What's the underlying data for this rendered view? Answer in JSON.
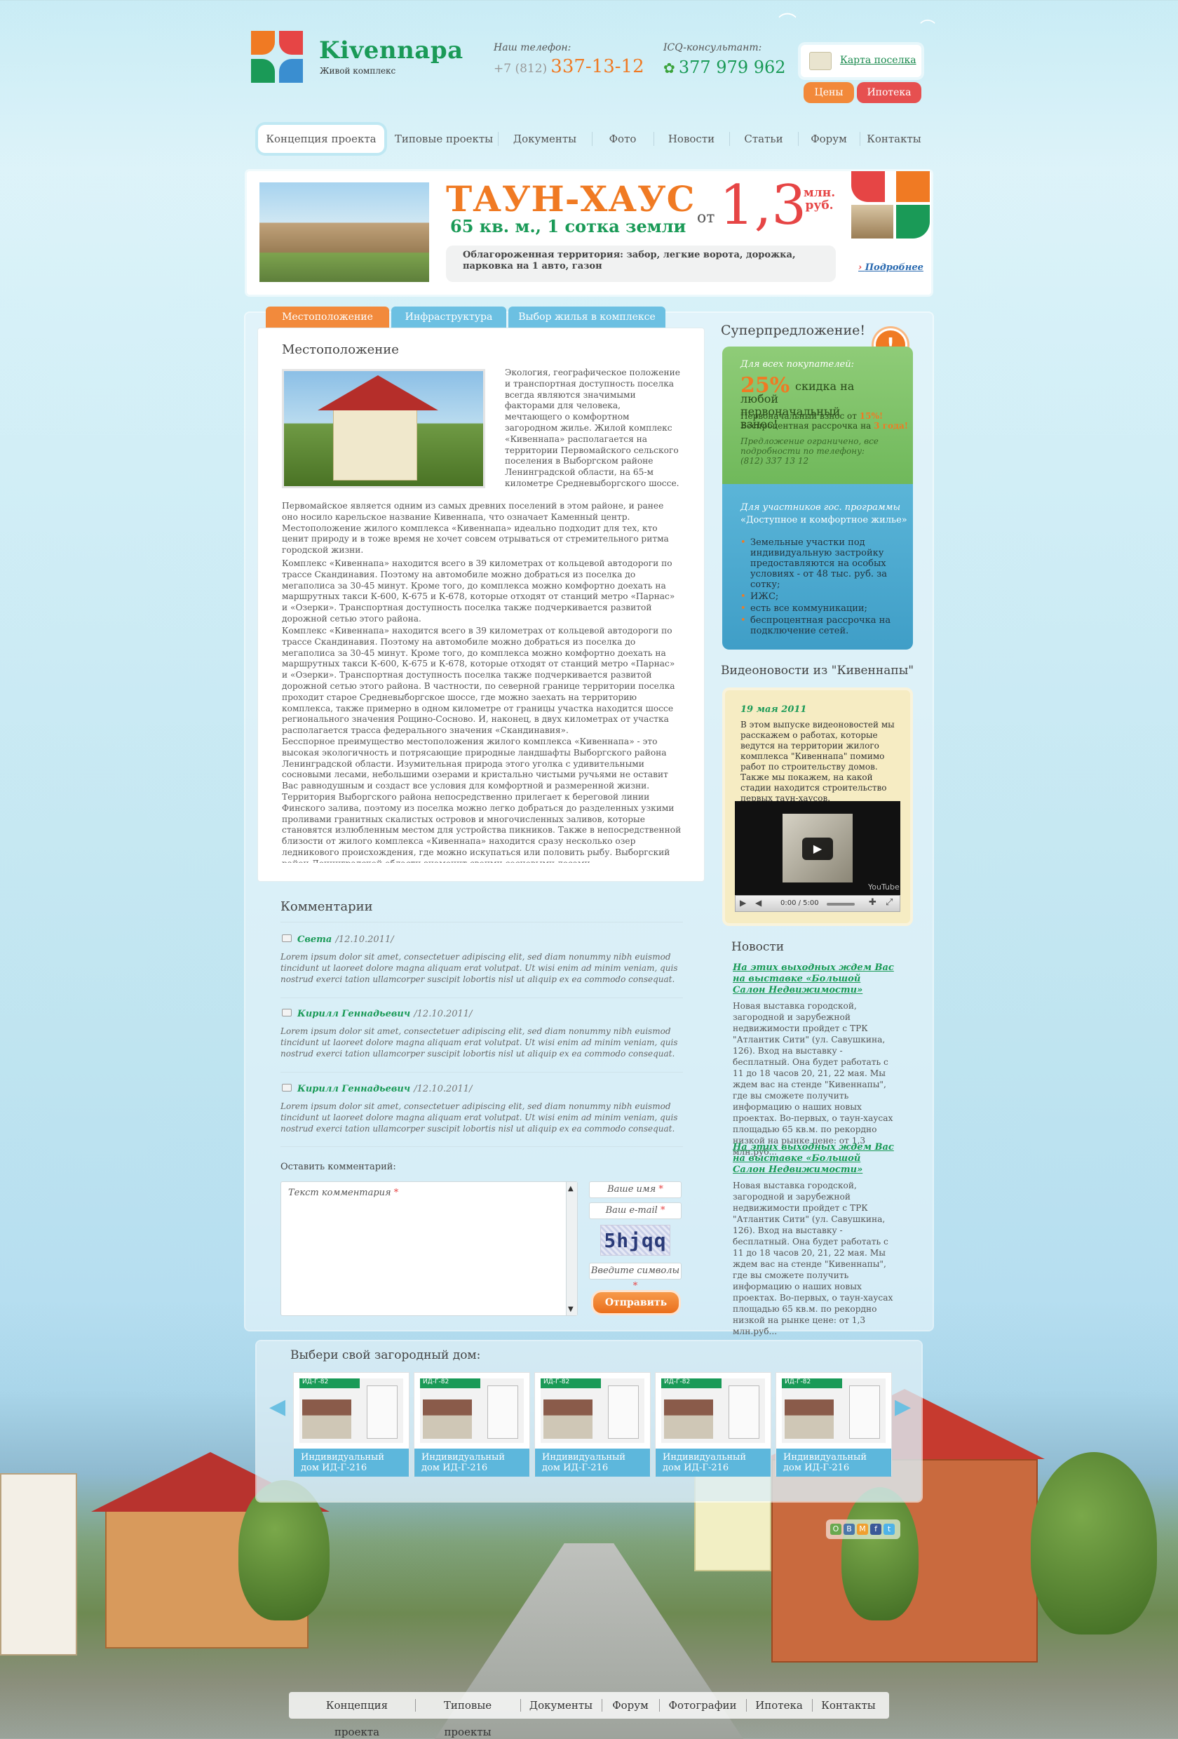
{
  "brand": {
    "name": "Kivennapa",
    "tagline": "Живой комплекс"
  },
  "header": {
    "phone_label": "Наш телефон:",
    "phone_prefix": "+7 (812)",
    "phone_number": "337-13-12",
    "icq_label": "ICQ-консультант:",
    "icq_number": "377 979 962",
    "map_link": "Карта поселка",
    "prices_button": "Цены",
    "mortgage_button": "Ипотека"
  },
  "nav": {
    "items": [
      "Концепция проекта",
      "Типовые проекты",
      "Документы",
      "Фото",
      "Новости",
      "Статьи",
      "Форум",
      "Контакты"
    ]
  },
  "banner": {
    "title": "ТАУН-ХАУС",
    "subtitle": "65 кв. м., 1 сотка земли",
    "price_prefix": "от",
    "price": "1,3",
    "price_unit_1": "млн.",
    "price_unit_2": "руб.",
    "description": "Облагороженная территория: забор, легкие ворота, дорожка, парковка на 1 авто, газон",
    "more_link": "Подробнее"
  },
  "tabs": [
    "Местоположение",
    "Инфраструктура",
    "Выбор жилья в комплексе"
  ],
  "article": {
    "heading": "Местоположение",
    "intro": "Экология, географическое положение и транспортная доступность поселка всегда являются значимыми факторами для человека, мечтающего о комфортном загородном жилье. Жилой комплекс «Кивеннапа» располагается на территории Первомайского сельского поселения в Выборгском районе Ленинградской области, на 65-м километре Средневыборгского шоссе.",
    "p1": "Первомайское является одним из самых древних поселений в этом районе, и ранее оно носило карельское название Кивеннапа, что означает Каменный центр. Местоположение жилого комплекса «Кивеннапа» идеально подходит для тех, кто ценит природу и в тоже время не хочет совсем отрываться от стремительного ритма городской жизни.",
    "p2": "Комплекс «Кивеннапа» находится всего в 39 километрах от кольцевой автодороги по трассе Скандинавия. Поэтому на автомобиле можно добраться из поселка до мегаполиса за 30-45 минут. Кроме того, до комплекса можно комфортно доехать на маршрутных такси К-600, К-675 и К-678, которые отходят от станций метро «Парнас» и «Озерки». Транспортная доступность поселка также подчеркивается развитой дорожной сетью этого района.",
    "p3": "Комплекс «Кивеннапа» находится всего в 39 километрах от кольцевой автодороги по трассе Скандинавия. Поэтому на автомобиле можно добраться из поселка до мегаполиса за 30-45 минут. Кроме того, до комплекса можно комфортно доехать на маршрутных такси К-600, К-675 и К-678, которые отходят от станций метро «Парнас» и «Озерки». Транспортная доступность поселка также подчеркивается развитой дорожной сетью этого района. В частности, по северной границе территории поселка проходит старое Средневыборгское шоссе, где можно заехать на территорию комплекса, также примерно в одном километре от границы участка находится шоссе регионального значения Рощино-Сосново. И, наконец, в двух километрах от участка располагается трасса федерального значения «Скандинавия».",
    "p4": "Бесспорное преимущество местоположения жилого комплекса «Кивеннапа» - это высокая экологичность и потрясающие природные ландшафты Выборгского района Ленинградской области. Изумительная природа этого уголка с удивительными сосновыми лесами, небольшими озерами и кристально чистыми ручьями не оставит Вас равнодушным и создаст все условия для комфортной и размеренной жизни. Территория Выборгского района непосредственно прилегает к береговой линии Финского залива, поэтому из поселка можно легко добраться до разделенных узкими проливами гранитных скалистых островов и многочисленных заливов, которые становятся излюбленным местом для устройства пикников. Также в непосредственной близости от жилого комплекса «Кивеннапа» находится сразу несколько озер ледникового происхождения, где можно искупаться или половить рыбу. Выборгский район Ленинградской области знаменит своими сосновыми лесами,"
  },
  "comments": {
    "heading": "Комментарии",
    "items": [
      {
        "name": "Света",
        "date": "/12.10.2011/",
        "text": "Lorem ipsum dolor sit amet, consectetuer adipiscing elit, sed diam nonummy nibh euismod tincidunt ut laoreet dolore magna aliquam erat volutpat. Ut wisi enim ad minim veniam, quis nostrud exerci tation ullamcorper suscipit lobortis nisl ut aliquip ex ea commodo consequat."
      },
      {
        "name": "Кирилл Геннадьевич",
        "date": "/12.10.2011/",
        "text": "Lorem ipsum dolor sit amet, consectetuer adipiscing elit, sed diam nonummy nibh euismod tincidunt ut laoreet dolore magna aliquam erat volutpat. Ut wisi enim ad minim veniam, quis nostrud exerci tation ullamcorper suscipit lobortis nisl ut aliquip ex ea commodo consequat."
      },
      {
        "name": "Кирилл Геннадьевич",
        "date": "/12.10.2011/",
        "text": "Lorem ipsum dolor sit amet, consectetuer adipiscing elit, sed diam nonummy nibh euismod tincidunt ut laoreet dolore magna aliquam erat volutpat. Ut wisi enim ad minim veniam, quis nostrud exerci tation ullamcorper suscipit lobortis nisl ut aliquip ex ea commodo consequat."
      }
    ],
    "form_label": "Оставить комментарий:",
    "text_placeholder": "Текст комментария",
    "name_placeholder": "Ваше имя",
    "email_placeholder": "Ваш e-mail",
    "captcha": "5hjqq",
    "captcha_placeholder": "Введите символы",
    "submit": "Отправить",
    "required_mark": "*"
  },
  "sidebar": {
    "offer_title": "Суперпредложение!",
    "offer_badge": "!",
    "green": {
      "label": "Для всех покупателей:",
      "percent": "25%",
      "discount": "скидка на любой первоначальный взнос!",
      "line1_a": "Первоначальный взнос от",
      "line1_b": "15%!",
      "line2_a": "Беспроцентная рассрочка на",
      "line2_b": "3 года!",
      "note": "Предложение ограничено, все подробности по телефону:",
      "phone": "(812) 337 13 12"
    },
    "blue": {
      "label": "Для участников гос. программы",
      "program": "«Доступное и комфортное жилье»",
      "bullets": [
        "Земельные участки под индивидуальную застройку предоставляются на особых условиях - от 48 тыс. руб. за сотку;",
        "ИЖС;",
        "есть все коммуникации;",
        "беспроцентная рассрочка на подключение сетей."
      ]
    },
    "video_title": "Видеоновости из \"Кивеннапы\"",
    "video": {
      "date": "19 мая 2011",
      "text": "В этом выпуске видеоновостей мы расскажем о работах, которые ведутся на территории жилого комплекса \"Кивеннапа\" помимо работ по строительству домов. Также мы покажем, на какой стадии находится строительство первых таун-хаусов.",
      "time": "0:00 / 5:00",
      "brand": "YouTube"
    },
    "news_title": "Новости",
    "news": [
      {
        "title": "На этих выходных ждем Вас на выставке «Большой Салон Недвижимости»",
        "text": "Новая выставка городской, загородной и зарубежной недвижимости пройдет с ТРК \"Атлантик Сити\" (ул. Савушкина, 126). Вход на выставку - бесплатный. Она будет работать с 11 до 18 часов 20, 21, 22 мая. Мы ждем вас на стенде \"Кивеннапы\", где вы сможете получить информацию о наших новых проектах. Во-первых, о таун-хаусах площадью 65 кв.м. по рекордно низкой на рынке цене: от 1,3 млн.руб..."
      },
      {
        "title": "На этих выходных ждем Вас на выставке «Большой Салон Недвижимости»",
        "text": "Новая выставка городской, загородной и зарубежной недвижимости пройдет с ТРК \"Атлантик Сити\" (ул. Савушкина, 126). Вход на выставку - бесплатный. Она будет работать с 11 до 18 часов 20, 21, 22 мая. Мы ждем вас на стенде \"Кивеннапы\", где вы сможете получить информацию о наших новых проектах. Во-первых, о таун-хаусах площадью 65 кв.м. по рекордно низкой на рынке цене: от 1,3 млн.руб..."
      }
    ]
  },
  "carousel": {
    "title": "Выбери свой загородный дом:",
    "card_tag": "ИД-Г-82",
    "cards": [
      "Индивидуальный дом ИД-Г-216",
      "Индивидуальный дом ИД-Г-216",
      "Индивидуальный дом ИД-Г-216",
      "Индивидуальный дом ИД-Г-216",
      "Индивидуальный дом ИД-Г-216"
    ]
  },
  "social": [
    "О",
    "В",
    "М",
    "f",
    "t"
  ],
  "footer": {
    "items": [
      "Концепция проекта",
      "Типовые проекты",
      "Документы",
      "Форум",
      "Фотографии",
      "Ипотека",
      "Контакты"
    ]
  },
  "colors": {
    "green": "#1a9a57",
    "orange": "#f07a23",
    "red": "#e64545",
    "blue": "#5bb5d8"
  }
}
